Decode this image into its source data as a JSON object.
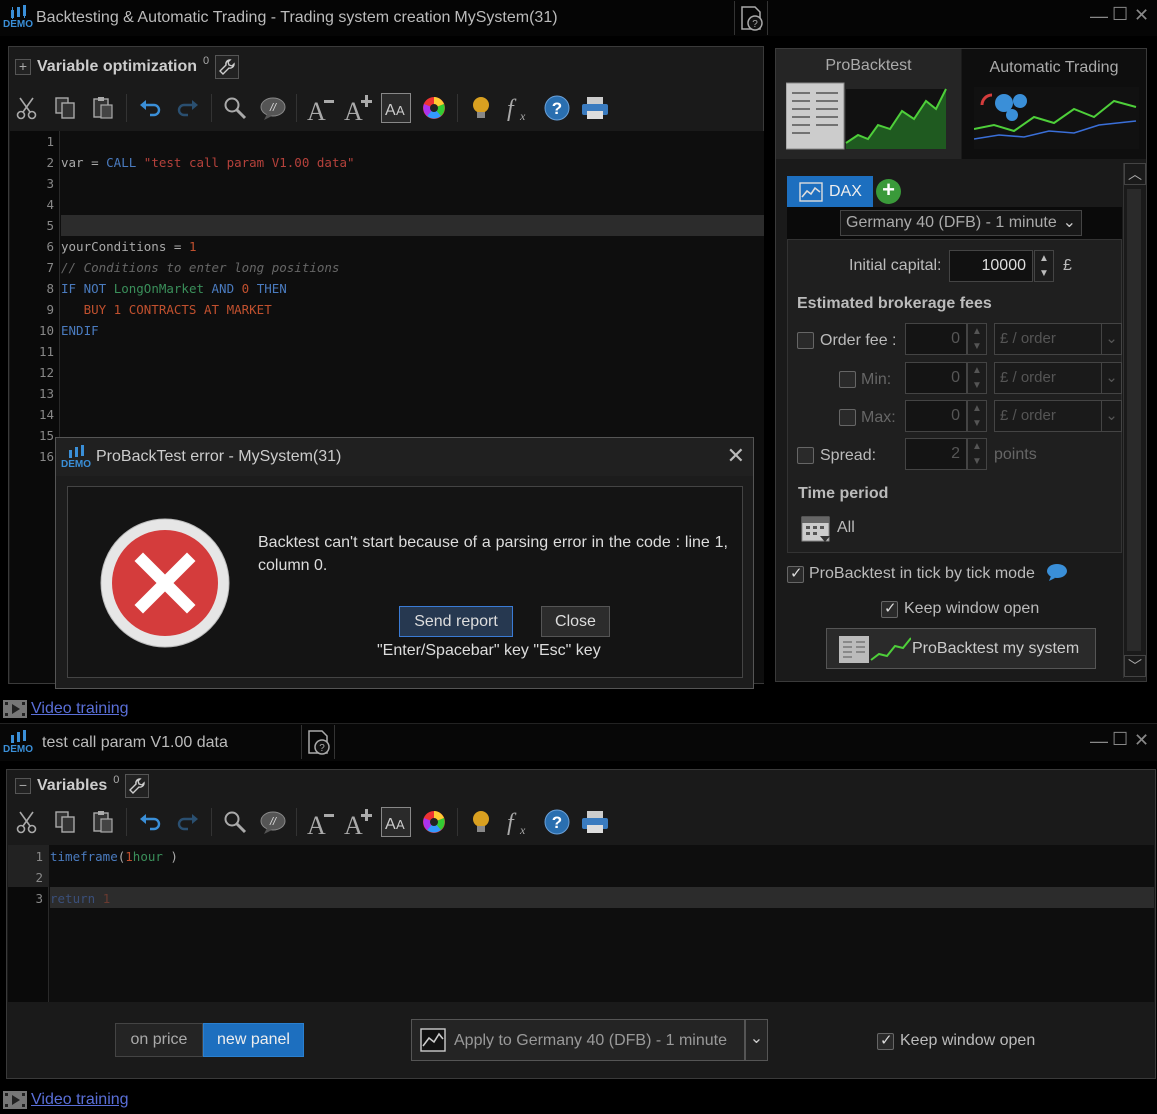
{
  "top_window": {
    "title": "Backtesting & Automatic Trading - Trading system creation",
    "system_name": "MySystem(31)",
    "demo_label": "DEMO"
  },
  "left_panel": {
    "header_label": "Variable optimization",
    "header_count": "0",
    "code_lines": [
      "1",
      "2",
      "3",
      "4",
      "5",
      "6",
      "7",
      "8",
      "9",
      "10",
      "11",
      "12",
      "13",
      "14",
      "15",
      "16"
    ]
  },
  "right_panel": {
    "tab_probacktest": "ProBacktest",
    "tab_automatic": "Automatic Trading",
    "instrument_tab": "DAX",
    "instrument_select": "Germany 40 (DFB) - 1 minute",
    "initial_capital_label": "Initial capital:",
    "initial_capital_value": "10000",
    "currency": "£",
    "fees_heading": "Estimated brokerage fees",
    "order_fee_label": "Order fee :",
    "order_fee_value": "0",
    "order_fee_unit": "£ / order",
    "min_label": "Min:",
    "min_value": "0",
    "min_unit": "£ / order",
    "max_label": "Max:",
    "max_value": "0",
    "max_unit": "£ / order",
    "spread_label": "Spread:",
    "spread_value": "2",
    "spread_unit": "points",
    "time_period_heading": "Time period",
    "time_period_value": "All",
    "tick_mode_label": "ProBacktest in tick by tick mode",
    "keep_open_label": "Keep window open",
    "run_button": "ProBacktest my system"
  },
  "video_training_top": "Video training",
  "dialog": {
    "title": "ProBackTest error - MySystem(31)",
    "message": "Backtest can't start because of a parsing error in the code : line 1, column 0.",
    "send_report": "Send report",
    "close": "Close",
    "hint": "\"Enter/Spacebar\" key \"Esc\" key",
    "demo_label": "DEMO"
  },
  "bottom_window": {
    "title": "test call param V1.00 data",
    "demo_label": "DEMO",
    "header_label": "Variables",
    "header_count": "0",
    "code_lines": [
      "1",
      "2",
      "3"
    ],
    "seg_on_price": "on price",
    "seg_new_panel": "new panel",
    "apply_label": "Apply to Germany 40 (DFB) - 1 minute",
    "keep_open_label": "Keep window open",
    "video_training": "Video training"
  },
  "colors": {
    "accent_blue": "#1d6fbf",
    "error_red": "#d43c3c"
  }
}
